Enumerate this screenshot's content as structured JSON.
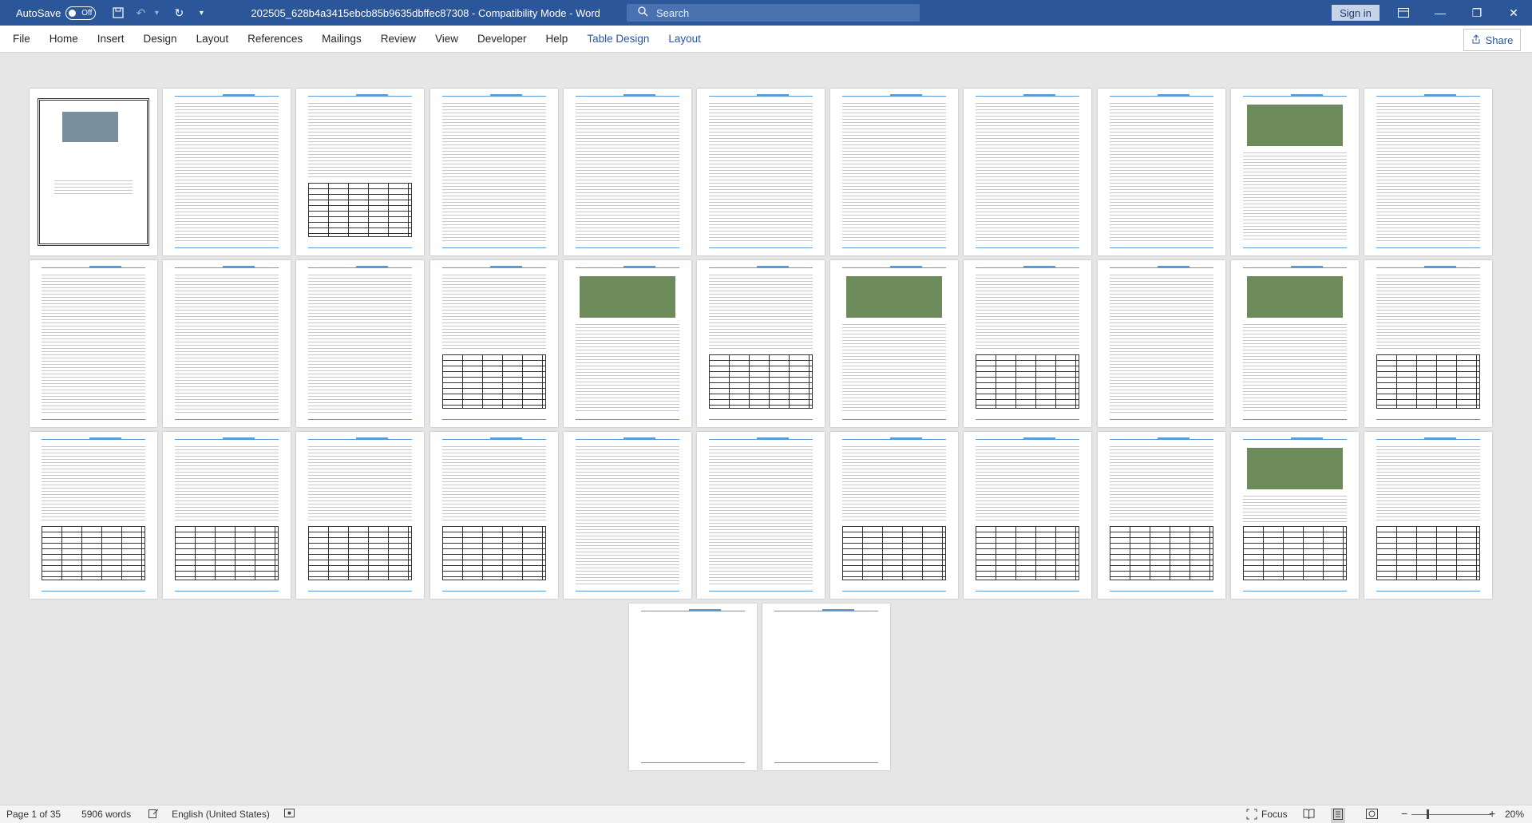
{
  "titlebar": {
    "autosave_label": "AutoSave",
    "autosave_state": "Off",
    "document_title": "202505_628b4a3415ebcb85b9635dbffec87308  -  Compatibility Mode  -  Word",
    "search_placeholder": "Search",
    "signin_label": "Sign in",
    "icons": [
      "save-icon",
      "undo-icon",
      "redo-icon",
      "customize-qat-icon",
      "ribbon-display-icon",
      "minimize-icon",
      "restore-icon",
      "close-icon"
    ]
  },
  "ribbon": {
    "tabs": [
      {
        "label": "File"
      },
      {
        "label": "Home"
      },
      {
        "label": "Insert"
      },
      {
        "label": "Design"
      },
      {
        "label": "Layout"
      },
      {
        "label": "References"
      },
      {
        "label": "Mailings"
      },
      {
        "label": "Review"
      },
      {
        "label": "View"
      },
      {
        "label": "Developer"
      },
      {
        "label": "Help"
      },
      {
        "label": "Table Design"
      },
      {
        "label": "Layout"
      }
    ],
    "share_label": "Share"
  },
  "document": {
    "page_count": 35
  },
  "statusbar": {
    "page_info": "Page 1 of 35",
    "word_count": "5906 words",
    "language": "English (United States)",
    "focus_label": "Focus",
    "zoom_minus": "−",
    "zoom_plus": "+",
    "zoom_level": "20%"
  },
  "colors": {
    "titlebar": "#2b579a",
    "contextual_tab": "#2b579a",
    "document_background": "#e6e6e6"
  }
}
